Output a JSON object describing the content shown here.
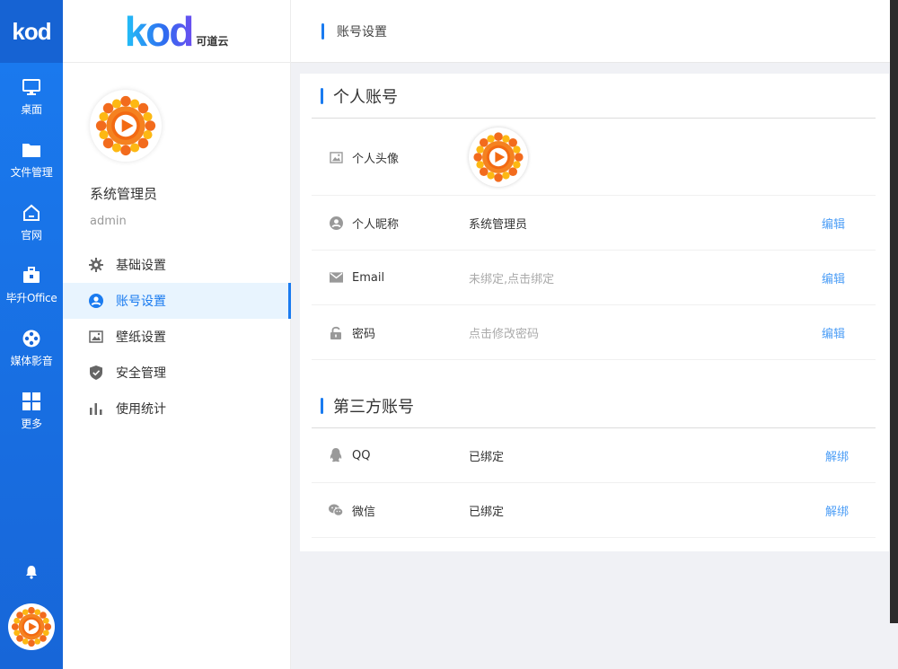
{
  "rail": {
    "logo": "kod",
    "items": [
      {
        "label": "桌面",
        "icon": "desktop-icon"
      },
      {
        "label": "文件管理",
        "icon": "folder-icon"
      },
      {
        "label": "官网",
        "icon": "home-icon"
      },
      {
        "label": "毕升Office",
        "icon": "toolbox-icon"
      },
      {
        "label": "媒体影音",
        "icon": "film-reel-icon"
      },
      {
        "label": "更多",
        "icon": "grid-icon"
      }
    ]
  },
  "brand": {
    "logo": "kod",
    "sub": "可道云"
  },
  "profile": {
    "display_name": "系统管理员",
    "username": "admin"
  },
  "menu": [
    {
      "label": "基础设置",
      "icon": "gear-icon"
    },
    {
      "label": "账号设置",
      "icon": "user-circle-icon",
      "active": true
    },
    {
      "label": "壁纸设置",
      "icon": "image-icon"
    },
    {
      "label": "安全管理",
      "icon": "shield-check-icon"
    },
    {
      "label": "使用统计",
      "icon": "bar-chart-icon"
    }
  ],
  "header": {
    "title": "账号设置"
  },
  "personal": {
    "title": "个人账号",
    "avatar_label": "个人头像",
    "nickname": {
      "label": "个人昵称",
      "value": "系统管理员",
      "action": "编辑"
    },
    "email": {
      "label": "Email",
      "value": "未绑定,点击绑定",
      "action": "编辑"
    },
    "password": {
      "label": "密码",
      "value": "点击修改密码",
      "action": "编辑"
    }
  },
  "third_party": {
    "title": "第三方账号",
    "qq": {
      "label": "QQ",
      "value": "已绑定",
      "action": "解绑"
    },
    "wechat": {
      "label": "微信",
      "value": "已绑定",
      "action": "解绑"
    }
  },
  "colors": {
    "accent": "#1a7bf0",
    "link": "#4d9ef6",
    "rail": "#1766d8"
  }
}
